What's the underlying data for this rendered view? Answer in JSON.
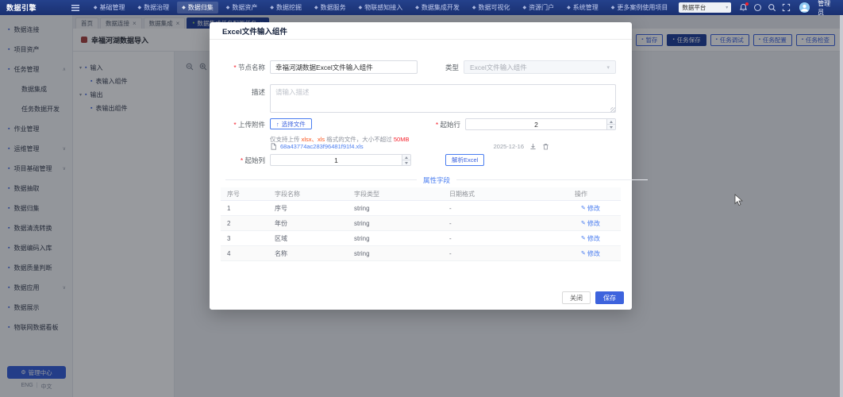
{
  "colors": {
    "primary": "#3d63dd",
    "navy": "#21409a",
    "navbar": "#1a3070",
    "danger": "#f5222d",
    "warning": "#fa541c"
  },
  "topbar": {
    "logo": "数据引擎",
    "menu_items": [
      {
        "label": "基础管理",
        "icon": "basic-mgmt-icon"
      },
      {
        "label": "数据治理",
        "icon": "data-governance-icon"
      },
      {
        "label": "数据归集",
        "icon": "data-collection-icon"
      },
      {
        "label": "数据资产",
        "icon": "data-asset-icon"
      },
      {
        "label": "数据挖掘",
        "icon": "data-mining-icon"
      },
      {
        "label": "数据服务",
        "icon": "data-service-icon"
      },
      {
        "label": "物联感知接入",
        "icon": "iot-access-icon"
      },
      {
        "label": "数据集成开发",
        "icon": "integration-dev-icon"
      },
      {
        "label": "数据可视化",
        "icon": "visualization-icon"
      },
      {
        "label": "资源门户",
        "icon": "portal-icon"
      },
      {
        "label": "系统管理",
        "icon": "system-mgmt-icon"
      },
      {
        "label": "更多案例使用项目",
        "icon": "more-projects-icon"
      }
    ],
    "active_index": 2,
    "workspace_select": "数据平台",
    "action_icons": [
      "notification-bell-icon",
      "theme-circle-icon",
      "search-icon",
      "fullscreen-icon"
    ],
    "username": "管理员"
  },
  "tabs": {
    "items": [
      {
        "label": "首页",
        "closable": false,
        "active": false
      },
      {
        "label": "数据连接",
        "closable": true,
        "active": false
      },
      {
        "label": "数据集成",
        "closable": true,
        "active": false
      },
      {
        "label": "数据集成任务配置任务",
        "closable": true,
        "active": true
      }
    ]
  },
  "sidebar": {
    "items": [
      {
        "label": "数据连接",
        "type": "item",
        "icon": "data-connection-icon"
      },
      {
        "label": "项目资产",
        "type": "item",
        "icon": "project-asset-icon"
      },
      {
        "label": "任务管理",
        "type": "group",
        "state": "expanded",
        "icon": "task-mgmt-icon"
      },
      {
        "label": "数据集成",
        "type": "child"
      },
      {
        "label": "任务数据开发",
        "type": "child"
      },
      {
        "label": "作业管理",
        "type": "item",
        "icon": "job-mgmt-icon"
      },
      {
        "label": "运维管理",
        "type": "group",
        "state": "collapsed",
        "icon": "ops-mgmt-icon"
      },
      {
        "label": "项目基础管理",
        "type": "group",
        "state": "collapsed",
        "icon": "project-base-icon"
      },
      {
        "label": "数据抽取",
        "type": "item",
        "icon": "data-extract-icon"
      },
      {
        "label": "数据归集",
        "type": "item",
        "icon": "data-collect-icon"
      },
      {
        "label": "数据清洗转换",
        "type": "item",
        "icon": "data-clean-icon"
      },
      {
        "label": "数据编码入库",
        "type": "item",
        "icon": "data-encode-icon"
      },
      {
        "label": "数据质量判断",
        "type": "item",
        "icon": "data-quality-icon"
      },
      {
        "label": "数据应用",
        "type": "group",
        "state": "collapsed",
        "icon": "data-app-icon"
      },
      {
        "label": "数据展示",
        "type": "item",
        "icon": "data-display-icon"
      },
      {
        "label": "物联网数据看板",
        "type": "item",
        "icon": "iot-dashboard-icon"
      }
    ],
    "bottom_button": "管理中心",
    "lang_left": "ENG",
    "lang_right": "中文"
  },
  "page": {
    "title": "幸福河湖数据导入",
    "toolbar": [
      "暂存",
      "任务保存",
      "任务调试",
      "任务配置",
      "任务检查"
    ],
    "tree": [
      {
        "label": "输入",
        "child": false,
        "icon": "input-group-icon"
      },
      {
        "label": "表输入组件",
        "child": true,
        "icon": "table-input-icon"
      },
      {
        "label": "输出",
        "child": false,
        "icon": "output-group-icon"
      },
      {
        "label": "表输出组件",
        "child": true,
        "icon": "table-output-icon"
      }
    ]
  },
  "modal": {
    "title": "Excel文件输入组件",
    "fields": {
      "node_name_label": "节点名称",
      "node_name_value": "幸福河湖数据Excel文件输入组件",
      "type_label": "类型",
      "type_value": "Excel文件输入组件",
      "desc_label": "描述",
      "desc_placeholder": "请输入描述",
      "upload_label": "上传附件",
      "upload_button": "选择文件",
      "start_row_label": "起始行",
      "start_row_value": "2",
      "hint_prefix": "仅支持上传 ",
      "hint_formats": "xlsx、xls",
      "hint_middle": " 格式的文件，大小不超过 ",
      "hint_size": "50MB",
      "file_name": "68a43774ac283f96481f91f4.xls",
      "file_date": "2025-12-16",
      "start_col_label": "起始列",
      "start_col_value": "1",
      "parse_button": "解析Excel",
      "divider_text": "属性字段"
    },
    "table": {
      "headers": [
        "序号",
        "字段名称",
        "字段类型",
        "日期格式",
        "操作"
      ],
      "action_label": "修改",
      "rows": [
        {
          "index": "1",
          "name": "序号",
          "type": "string",
          "date_format": "-"
        },
        {
          "index": "2",
          "name": "年份",
          "type": "string",
          "date_format": "-"
        },
        {
          "index": "3",
          "name": "区域",
          "type": "string",
          "date_format": "-"
        },
        {
          "index": "4",
          "name": "名称",
          "type": "string",
          "date_format": "-"
        }
      ]
    },
    "footer": {
      "close": "关闭",
      "save": "保存"
    }
  }
}
